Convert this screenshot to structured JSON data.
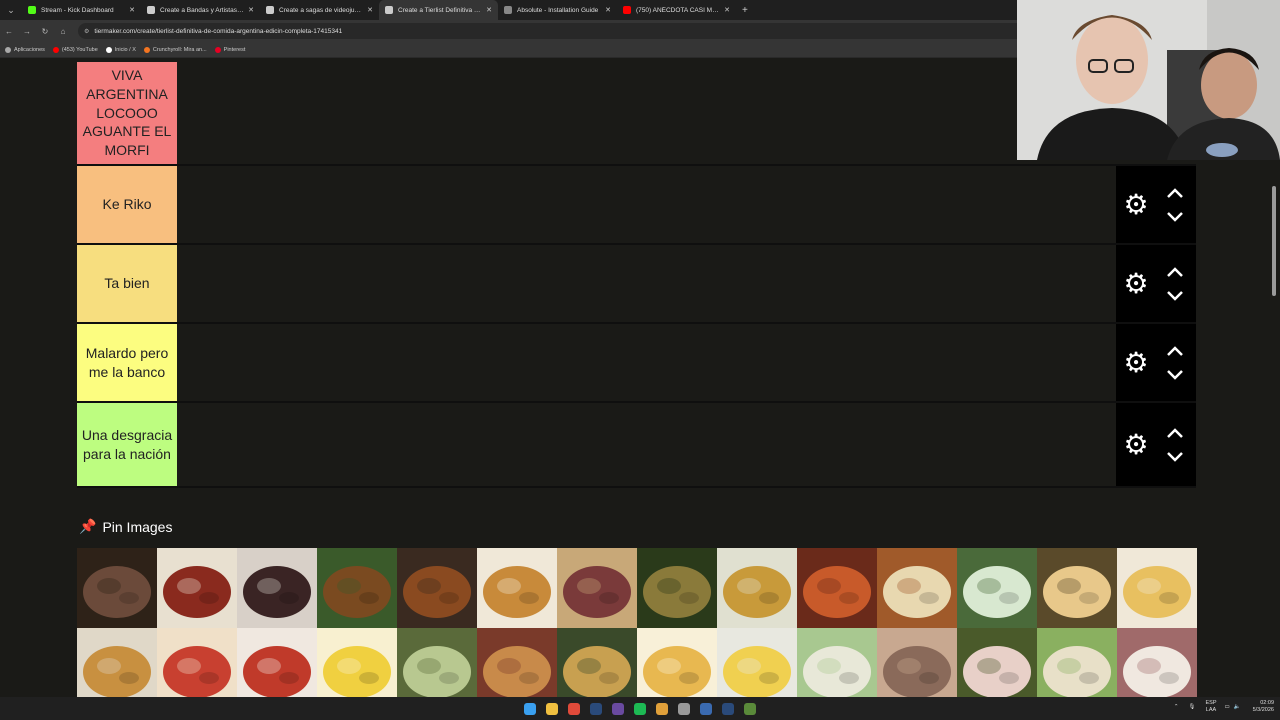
{
  "browser": {
    "tabs": [
      {
        "title": "Stream - Kick Dashboard",
        "icon": "kick-icon",
        "color": "#53fc18",
        "active": false
      },
      {
        "title": "Create a Bandas y Artistas de R",
        "icon": "tiermaker-icon",
        "color": "#cccccc",
        "active": false
      },
      {
        "title": "Create a sagas de videojuegos",
        "icon": "tiermaker-icon",
        "color": "#cccccc",
        "active": false
      },
      {
        "title": "Create a Tierlist Definitiva de C",
        "icon": "tiermaker-icon",
        "color": "#cccccc",
        "active": true
      },
      {
        "title": "Absolute - Installation Guide",
        "icon": "pen-icon",
        "color": "#888888",
        "active": false
      },
      {
        "title": "(750) ANÉCDOTA CASI ME MA",
        "icon": "youtube-icon",
        "color": "#ff0000",
        "active": false
      }
    ],
    "url": "tiermaker.com/create/tierlist-definitiva-de-comida-argentina-edicin-completa-17415341",
    "bookmarks": [
      {
        "label": "Aplicaciones",
        "icon": "apps-icon",
        "color": "#aaaaaa"
      },
      {
        "label": "(453) YouTube",
        "icon": "youtube-icon",
        "color": "#ff0000"
      },
      {
        "label": "Inicio / X",
        "icon": "x-icon",
        "color": "#ffffff"
      },
      {
        "label": "Crunchyroll: Mira an...",
        "icon": "crunchyroll-icon",
        "color": "#f47521"
      },
      {
        "label": "Pinterest",
        "icon": "pinterest-icon",
        "color": "#e60023"
      }
    ]
  },
  "tiers": [
    {
      "label": "VIVA ARGENTINA LOCOOO AGUANTE EL MORFI",
      "color": "#f47e7f"
    },
    {
      "label": "Ke Riko",
      "color": "#f8bf7f"
    },
    {
      "label": "Ta bien",
      "color": "#f7de7f"
    },
    {
      "label": "Malardo pero me la banco",
      "color": "#fcfd80"
    },
    {
      "label": "Una desgracia para la nación",
      "color": "#bdfd80"
    }
  ],
  "pin_section": {
    "title": "Pin Images"
  },
  "food_images": [
    {
      "name": "asado-image",
      "colors": [
        "#6b4a3a",
        "#2e2218"
      ]
    },
    {
      "name": "choripan-image",
      "colors": [
        "#8a2a1e",
        "#e8e0d0"
      ]
    },
    {
      "name": "morcilla-image",
      "colors": [
        "#3a2424",
        "#d8d0c8"
      ]
    },
    {
      "name": "guiso-image",
      "colors": [
        "#7a4a20",
        "#3a5a2a"
      ]
    },
    {
      "name": "cordero-image",
      "colors": [
        "#8a4a20",
        "#3a2a20"
      ]
    },
    {
      "name": "milanesa-image",
      "colors": [
        "#c88a3a",
        "#f0e8d8"
      ]
    },
    {
      "name": "picada-image",
      "colors": [
        "#7a3a3a",
        "#c8a878"
      ]
    },
    {
      "name": "puchero-image",
      "colors": [
        "#8a7a3a",
        "#2a3a1a"
      ]
    },
    {
      "name": "locro-image",
      "colors": [
        "#c89a3a",
        "#e0e0d0"
      ]
    },
    {
      "name": "mondongo-image",
      "colors": [
        "#c85a2a",
        "#6a2a1a"
      ]
    },
    {
      "name": "empanadas-image",
      "colors": [
        "#e8d8b0",
        "#a05a2a"
      ]
    },
    {
      "name": "pascualina-image",
      "colors": [
        "#d8e8d0",
        "#4a6a3a"
      ]
    },
    {
      "name": "fugazzeta-image",
      "colors": [
        "#e8c88a",
        "#5a4a2a"
      ]
    },
    {
      "name": "tortilla-image",
      "colors": [
        "#e8c060",
        "#f0e8d8"
      ]
    },
    {
      "name": "canelones-image",
      "colors": [
        "#c89040",
        "#e0d8c8"
      ]
    },
    {
      "name": "ravioles-image",
      "colors": [
        "#c84030",
        "#f0e0c8"
      ]
    },
    {
      "name": "noquis-image",
      "colors": [
        "#c03a2a",
        "#f0e8e0"
      ]
    },
    {
      "name": "polenta-image",
      "colors": [
        "#f0d040",
        "#f8f0d0"
      ]
    },
    {
      "name": "humita-image",
      "colors": [
        "#b8c890",
        "#5a6a3a"
      ]
    },
    {
      "name": "lasagna-image",
      "colors": [
        "#c88a4a",
        "#7a3a2a"
      ]
    },
    {
      "name": "fideos-image",
      "colors": [
        "#c8a050",
        "#3a4a2a"
      ]
    },
    {
      "name": "papas-image",
      "colors": [
        "#e8b850",
        "#f8f0d8"
      ]
    },
    {
      "name": "huevos-rellenos-image",
      "colors": [
        "#f0d050",
        "#e8e8e0"
      ]
    },
    {
      "name": "ensalada-rusa-image",
      "colors": [
        "#e8e8d8",
        "#a8c890"
      ]
    },
    {
      "name": "matambre-image",
      "colors": [
        "#8a6a5a",
        "#c8a890"
      ]
    },
    {
      "name": "vitel-tone-image",
      "colors": [
        "#e8d0c8",
        "#4a5a2a"
      ]
    },
    {
      "name": "sandwich-miga-image",
      "colors": [
        "#e8e0c8",
        "#8ab060"
      ]
    },
    {
      "name": "arrollado-image",
      "colors": [
        "#f0e8e0",
        "#a06a6a"
      ]
    }
  ],
  "taskbar": {
    "apps": [
      {
        "name": "windows-start-icon",
        "color": "#3aa0f0"
      },
      {
        "name": "file-explorer-icon",
        "color": "#f0c040"
      },
      {
        "name": "chrome-icon",
        "color": "#e04a3a"
      },
      {
        "name": "steam-icon",
        "color": "#2a4a7a"
      },
      {
        "name": "obs-icon",
        "color": "#6a4aa0"
      },
      {
        "name": "spotify-icon",
        "color": "#1db954"
      },
      {
        "name": "chrome-profile-icon",
        "color": "#e0a03a"
      },
      {
        "name": "settings-icon",
        "color": "#9a9a9a"
      },
      {
        "name": "app-icon",
        "color": "#3a6ab0"
      },
      {
        "name": "steam-icon-2",
        "color": "#2a4a7a"
      },
      {
        "name": "minecraft-icon",
        "color": "#5a8a3a"
      }
    ],
    "lang": "ESP",
    "lang_sub": "LAA",
    "time": "02:09",
    "date": "5/3/2026"
  },
  "webcam": {
    "label": "streamer-webcam"
  }
}
